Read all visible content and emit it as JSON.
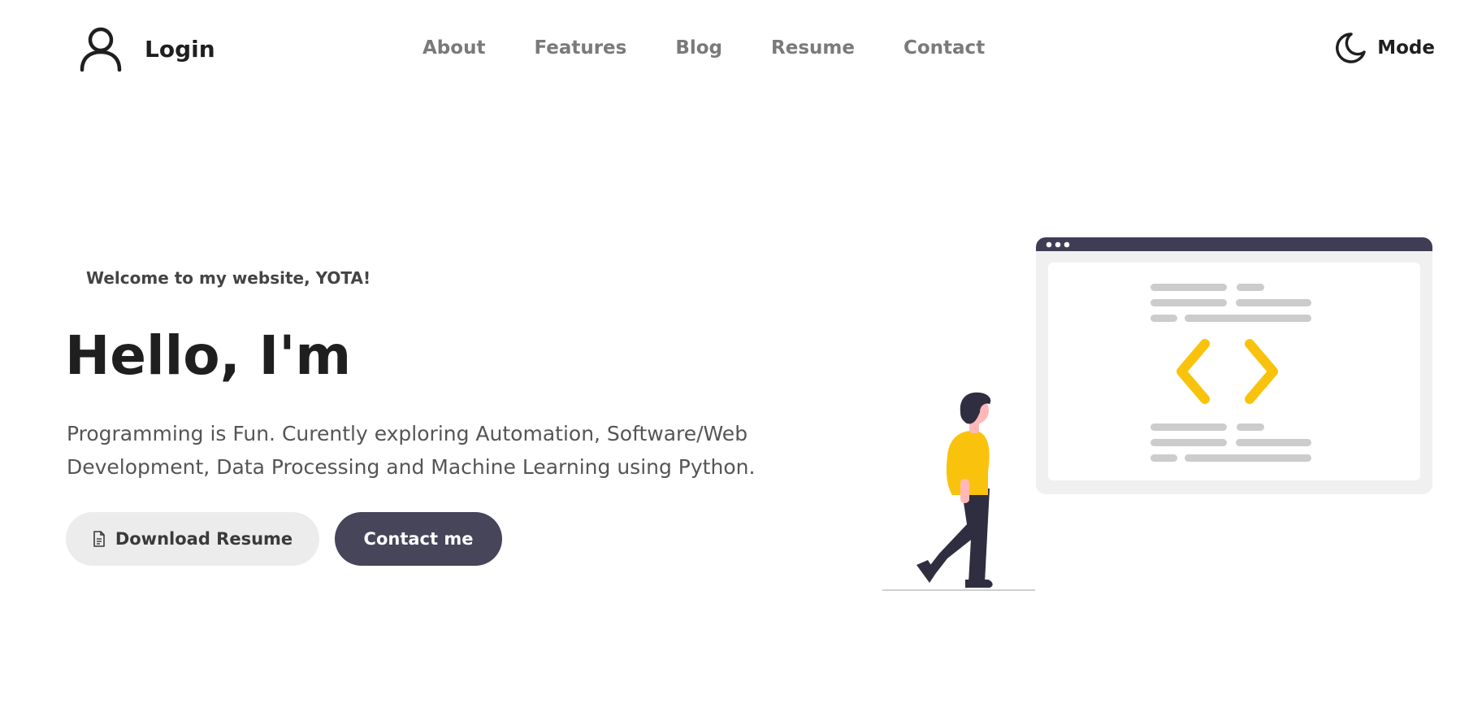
{
  "header": {
    "login_label": "Login",
    "nav": [
      "About",
      "Features",
      "Blog",
      "Resume",
      "Contact"
    ],
    "mode_label": "Mode"
  },
  "hero": {
    "welcome": "Welcome to my website, YOTA!",
    "title": "Hello, I'm",
    "description": "Programming is Fun. Curently exploring Automation, Software/Web Development, Data Processing and Machine Learning using Python.",
    "download_label": "Download Resume",
    "contact_label": "Contact me"
  },
  "icons": {
    "login": "user-icon",
    "mode": "moon-icon",
    "download": "document-icon",
    "illustration": "code-window-illustration"
  },
  "colors": {
    "accent_yellow": "#f9c30d",
    "dark_button": "#46455a",
    "light_button": "#ececec",
    "nav_text": "#7a7a7a"
  }
}
